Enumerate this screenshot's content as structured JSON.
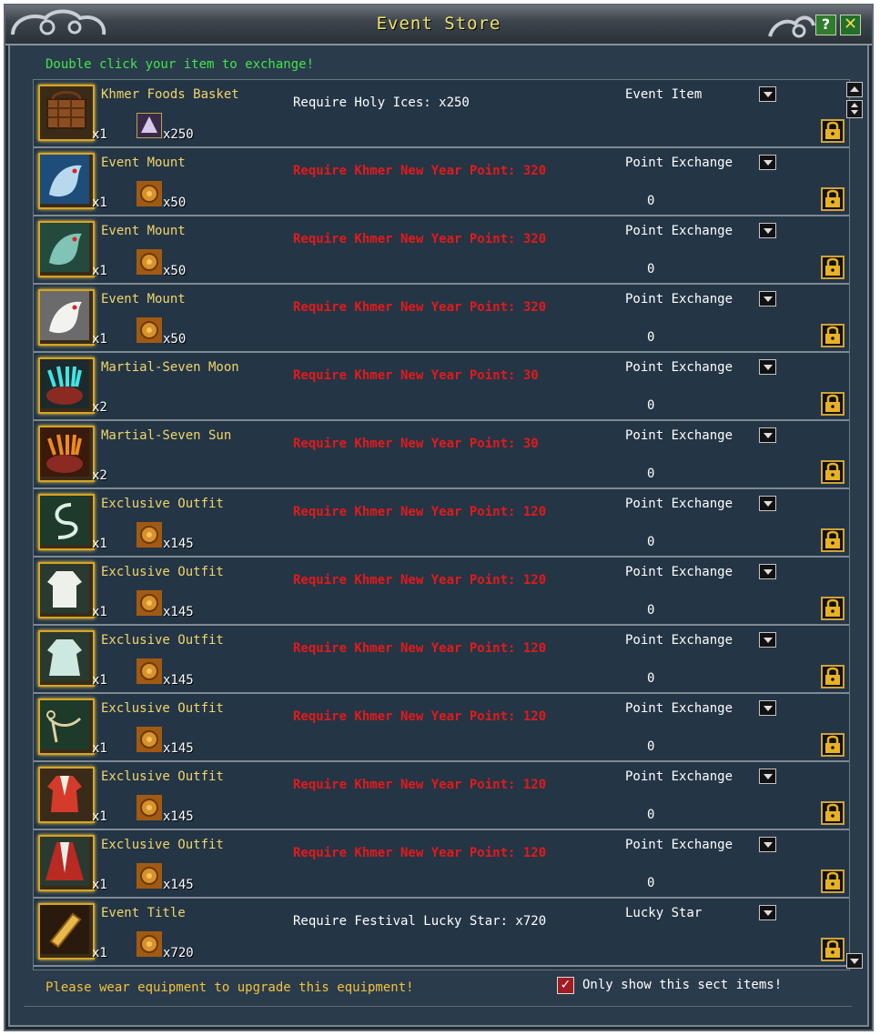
{
  "window": {
    "title": "Event Store",
    "help_label": "?",
    "close_label": "✕"
  },
  "hint": "Double click your item to exchange!",
  "items": [
    {
      "name": "Khmer Foods Basket",
      "qty": "x1",
      "cost_qty": "x250",
      "cost_icon": "holy-ice-icon",
      "icon": "basket-icon",
      "requirement": "Require Holy Ices: x250",
      "req_color": "white",
      "category": "Event Item",
      "points": ""
    },
    {
      "name": "Event Mount",
      "qty": "x1",
      "cost_qty": "x50",
      "cost_icon": "coin-icon",
      "icon": "blue-dragon-mount-icon",
      "requirement": "Require Khmer New Year Point: 320",
      "req_color": "red",
      "category": "Point Exchange",
      "points": "0"
    },
    {
      "name": "Event Mount",
      "qty": "x1",
      "cost_qty": "x50",
      "cost_icon": "coin-icon",
      "icon": "green-dragon-mount-icon",
      "requirement": "Require Khmer New Year Point: 320",
      "req_color": "red",
      "category": "Point Exchange",
      "points": "0"
    },
    {
      "name": "Event Mount",
      "qty": "x1",
      "cost_qty": "x50",
      "cost_icon": "coin-icon",
      "icon": "white-dragon-mount-icon",
      "requirement": "Require Khmer New Year Point: 320",
      "req_color": "red",
      "category": "Point Exchange",
      "points": "0"
    },
    {
      "name": "Martial-Seven Moon",
      "qty": "x2",
      "cost_qty": "",
      "cost_icon": "",
      "icon": "cauldron-moon-icon",
      "requirement": "Require Khmer New Year Point: 30",
      "req_color": "red",
      "category": "Point Exchange",
      "points": "0"
    },
    {
      "name": "Martial-Seven Sun",
      "qty": "x2",
      "cost_qty": "",
      "cost_icon": "",
      "icon": "cauldron-sun-icon",
      "requirement": "Require Khmer New Year Point: 30",
      "req_color": "red",
      "category": "Point Exchange",
      "points": "0"
    },
    {
      "name": "Exclusive Outfit",
      "qty": "x1",
      "cost_qty": "x145",
      "cost_icon": "coin-icon",
      "icon": "sash-outfit-icon",
      "requirement": "Require Khmer New Year Point: 120",
      "req_color": "red",
      "category": "Point Exchange",
      "points": "0"
    },
    {
      "name": "Exclusive Outfit",
      "qty": "x1",
      "cost_qty": "x145",
      "cost_icon": "coin-icon",
      "icon": "white-robe-outfit-icon",
      "requirement": "Require Khmer New Year Point: 120",
      "req_color": "red",
      "category": "Point Exchange",
      "points": "0"
    },
    {
      "name": "Exclusive Outfit",
      "qty": "x1",
      "cost_qty": "x145",
      "cost_icon": "coin-icon",
      "icon": "teal-robe-outfit-icon",
      "requirement": "Require Khmer New Year Point: 120",
      "req_color": "red",
      "category": "Point Exchange",
      "points": "0"
    },
    {
      "name": "Exclusive Outfit",
      "qty": "x1",
      "cost_qty": "x145",
      "cost_icon": "coin-icon",
      "icon": "belt-outfit-icon",
      "requirement": "Require Khmer New Year Point: 120",
      "req_color": "red",
      "category": "Point Exchange",
      "points": "0"
    },
    {
      "name": "Exclusive Outfit",
      "qty": "x1",
      "cost_qty": "x145",
      "cost_icon": "coin-icon",
      "icon": "red-robe-outfit-icon",
      "requirement": "Require Khmer New Year Point: 120",
      "req_color": "red",
      "category": "Point Exchange",
      "points": "0"
    },
    {
      "name": "Exclusive Outfit",
      "qty": "x1",
      "cost_qty": "x145",
      "cost_icon": "coin-icon",
      "icon": "cape-outfit-icon",
      "requirement": "Require Khmer New Year Point: 120",
      "req_color": "red",
      "category": "Point Exchange",
      "points": "0"
    },
    {
      "name": "Event Title",
      "qty": "x1",
      "cost_qty": "x720",
      "cost_icon": "coin-icon",
      "icon": "scroll-title-icon",
      "requirement": "Require Festival Lucky Star: x720",
      "req_color": "white",
      "category": "Lucky Star",
      "points": ""
    }
  ],
  "footer": {
    "message": "Please wear equipment to upgrade this equipment!",
    "checkbox_label": "Only show this sect items!",
    "checkbox_checked": true,
    "checkbox_mark": "✓"
  },
  "colors": {
    "panel": "#2a3b4c",
    "title_text": "#f2e36d",
    "hint_text": "#41e64a",
    "item_name": "#f1d66a",
    "requirement_red": "#e21a1a",
    "footer_text": "#f2c23c"
  }
}
